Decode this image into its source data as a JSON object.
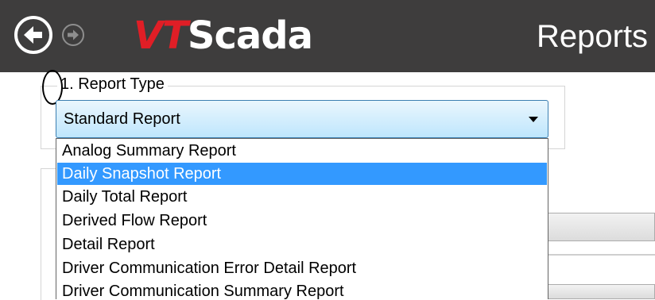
{
  "header": {
    "logo_vt": "VT",
    "logo_scada": "Scada",
    "page_title": "Reports",
    "back_icon": "arrow-left-circle-icon",
    "forward_icon": "arrow-right-circle-icon",
    "background_color": "#3e3d3d",
    "logo_accent_color": "#e01e26"
  },
  "report_type": {
    "step_label": "1. Report Type",
    "selected_value": "Standard Report",
    "options": [
      "Analog Summary Report",
      "Daily Snapshot Report",
      "Daily Total Report",
      "Derived Flow Report",
      "Detail Report",
      "Driver Communication Error Detail Report",
      "Driver Communication Summary Report"
    ],
    "highlighted_index": 1,
    "highlight_color": "#3399ff"
  }
}
